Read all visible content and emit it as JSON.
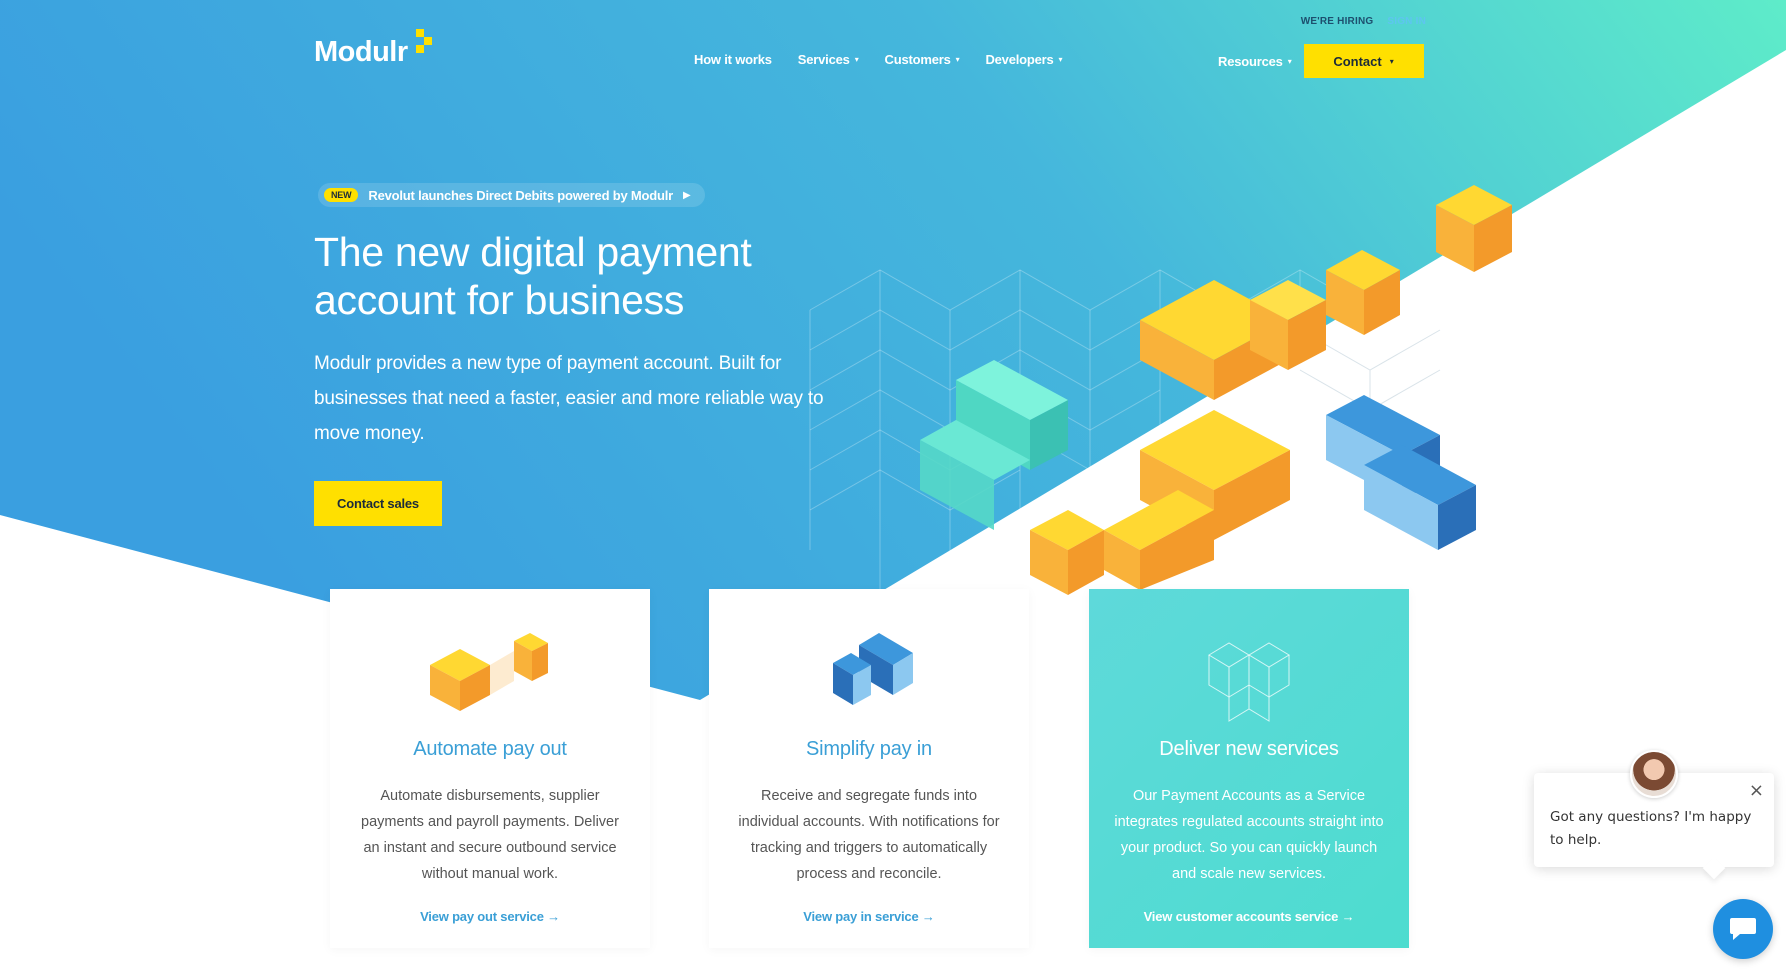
{
  "header": {
    "logo_text": "Modulr",
    "top_links": {
      "hiring": "WE'RE HIRING",
      "signin": "SIGN IN"
    },
    "nav": [
      {
        "label": "How it works",
        "has_dropdown": false
      },
      {
        "label": "Services",
        "has_dropdown": true
      },
      {
        "label": "Customers",
        "has_dropdown": true
      },
      {
        "label": "Developers",
        "has_dropdown": true
      }
    ],
    "resources_label": "Resources",
    "contact_label": "Contact"
  },
  "hero": {
    "badge": "NEW",
    "announcement": "Revolut launches Direct Debits powered by Modulr",
    "title": "The new digital payment account for business",
    "subtitle": "Modulr provides a new type of payment account. Built for businesses that need a faster, easier and more reliable way to move money.",
    "cta": "Contact sales"
  },
  "cards": [
    {
      "title": "Automate pay out",
      "text": "Automate disbursements, supplier payments and payroll payments. Deliver an instant and secure outbound service without manual work.",
      "link": "View pay out service →"
    },
    {
      "title": "Simplify pay in",
      "text": "Receive and segregate funds into individual accounts. With notifications for tracking and triggers to automatically process and reconcile.",
      "link": "View pay in service →"
    },
    {
      "title": "Deliver new services",
      "text": "Our Payment Accounts as a Service integrates regulated accounts straight into your product. So you can quickly launch and scale new services.",
      "link": "View customer accounts service →"
    }
  ],
  "chat": {
    "message": "Got any questions? I'm happy to help.",
    "close_icon": "×"
  },
  "colors": {
    "hero_start": "#3a9fe0",
    "hero_end": "#5eecc9",
    "accent_yellow": "#ffe000",
    "link_blue": "#3a9fd6",
    "teal_card": "#56dbd3"
  }
}
